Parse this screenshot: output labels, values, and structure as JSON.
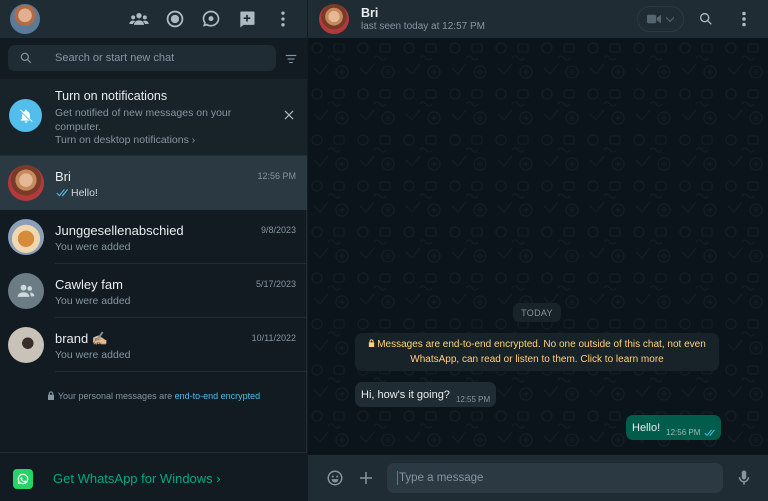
{
  "header": {
    "icons": [
      "communities-icon",
      "status-icon",
      "channels-icon",
      "new-chat-icon",
      "menu-icon"
    ]
  },
  "search": {
    "placeholder": "Search or start new chat"
  },
  "notification": {
    "title": "Turn on notifications",
    "text": "Get notified of new messages on your computer.",
    "link": "Turn on desktop notifications ›"
  },
  "chats": [
    {
      "name": "Bri",
      "time": "12:56 PM",
      "last": "Hello!",
      "active": true,
      "ticks": true
    },
    {
      "name": "Junggesellenabschied",
      "time": "9/8/2023",
      "last": "You were added"
    },
    {
      "name": "Cawley fam",
      "time": "5/17/2023",
      "last": "You were added"
    },
    {
      "name": "brand ✍🏼",
      "time": "10/11/2022",
      "last": "You were added"
    }
  ],
  "footer_note": {
    "text": "Your personal messages are ",
    "link": "end-to-end encrypted"
  },
  "get_app": {
    "label": "Get WhatsApp for Windows ›"
  },
  "conversation": {
    "name": "Bri",
    "status": "last seen today at 12:57 PM",
    "day": "TODAY",
    "encryption_notice": "Messages are end-to-end encrypted. No one outside of this chat, not even WhatsApp, can read or listen to them. Click to learn more",
    "messages": [
      {
        "direction": "in",
        "text": "Hi, how's it going?",
        "time": "12:55 PM"
      },
      {
        "direction": "out",
        "text": "Hello!",
        "time": "12:56 PM"
      }
    ]
  },
  "composer": {
    "placeholder": "Type a message"
  },
  "colors": {
    "accent": "#00a884",
    "outgoing_bubble": "#005c4b",
    "read_ticks": "#53bdeb",
    "background": "#111b21"
  }
}
